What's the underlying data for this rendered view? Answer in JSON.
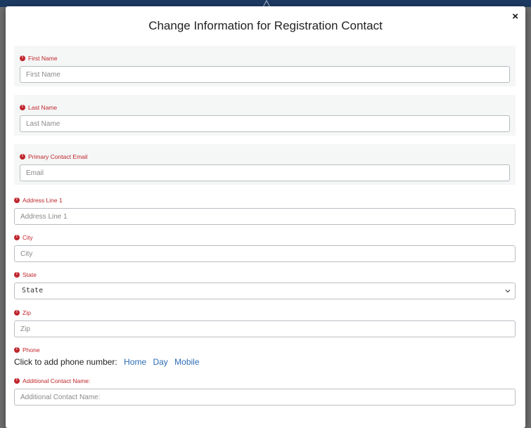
{
  "modal": {
    "title": "Change Information for Registration Contact",
    "close_label": "×"
  },
  "fields": {
    "first_name": {
      "label": "First Name",
      "placeholder": "First Name"
    },
    "last_name": {
      "label": "Last Name",
      "placeholder": "Last Name"
    },
    "email": {
      "label": "Primary Contact Email",
      "placeholder": "Email"
    },
    "address1": {
      "label": "Address Line 1",
      "placeholder": "Address Line 1"
    },
    "city": {
      "label": "City",
      "placeholder": "City"
    },
    "state": {
      "label": "State",
      "selected": "State"
    },
    "zip": {
      "label": "Zip",
      "placeholder": "Zip"
    },
    "phone": {
      "label": "Phone",
      "prompt": "Click to add phone number:",
      "options": [
        "Home",
        "Day",
        "Mobile"
      ]
    },
    "additional_contact": {
      "label": "Additional Contact Name:",
      "placeholder": "Additional Contact Name:"
    }
  },
  "icons": {
    "required": "exclamation-circle-icon",
    "close": "close-icon",
    "dropdown": "chevron-down-icon"
  },
  "colors": {
    "required_red": "#c0262d",
    "link_blue": "#2d6db5",
    "header_navy": "#1d3a63"
  }
}
